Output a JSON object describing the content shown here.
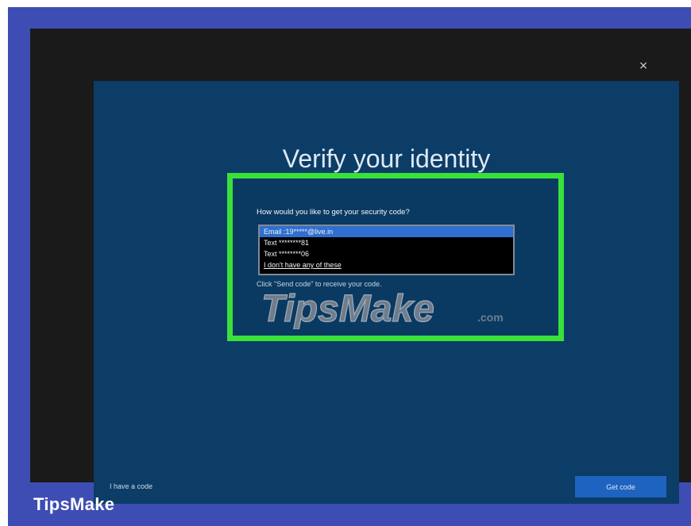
{
  "window": {
    "close_glyph": "×",
    "close_icon": "close-icon"
  },
  "dialog": {
    "title": "Verify your identity",
    "question": "How would you like to get your security code?",
    "options": [
      "Email :19*****@live.in",
      "Text ********81",
      "Text ********06",
      "I don't have any of these"
    ],
    "selected_option": "Email :19*****@live.in",
    "hint": "Click \"Send code\" to receive your code.",
    "have_code_link": "I have a code",
    "get_code_button": "Get code"
  },
  "overlay": {
    "watermark_text": "TipsMake",
    "watermark_suffix": ".com",
    "highlight_color": "#39e13b"
  },
  "branding": {
    "label": "TipsMake",
    "background": "#3d4db3"
  }
}
